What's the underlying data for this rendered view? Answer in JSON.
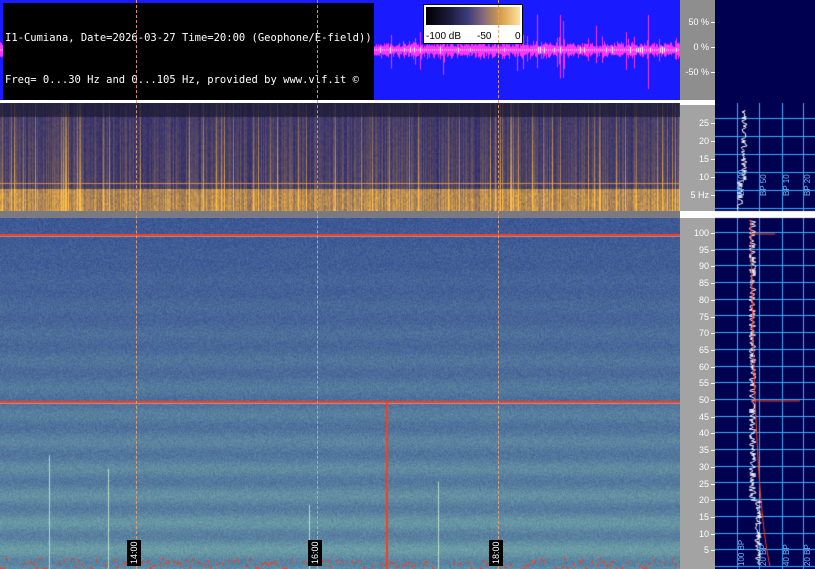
{
  "header": {
    "line1": "I1-Cumiana, Date=2026-03-27 Time=20:00 (Geophone/E-field))",
    "line2": "Freq= 0...30 Hz and 0...105 Hz, provided by www.vlf.it ©"
  },
  "colorbar": {
    "labels": [
      "-100 dB",
      "-50",
      "0"
    ]
  },
  "waveform_axis": {
    "ticks": [
      "50 %",
      "0 %",
      "-50 %"
    ]
  },
  "top_axis": {
    "ticks": [
      "25",
      "20",
      "15",
      "10",
      "5",
      "5 Hz"
    ]
  },
  "main_axis": {
    "ticks": [
      "100",
      "95",
      "90",
      "85",
      "80",
      "75",
      "70",
      "65",
      "60",
      "55",
      "50",
      "45",
      "40",
      "35",
      "30",
      "25",
      "20",
      "15",
      "10",
      "5"
    ]
  },
  "spectrum_panel": {
    "top_labels": [
      "BP 100",
      "BP 50",
      "BP 10",
      "BP 20"
    ],
    "bottom_labels": [
      "100 BP",
      "20 BP",
      "40 BP",
      "20 BP"
    ]
  },
  "time_markers": [
    "14:00",
    "16:00",
    "18:00"
  ],
  "colors": {
    "waveform_bg": "#1a1aff",
    "waveform_trace": "#ff33ff",
    "spectrum_bg": "#000050",
    "grid": "#3cb0ff",
    "marker_line": "#e8a070",
    "hum_line": "#ff3b1a"
  }
}
